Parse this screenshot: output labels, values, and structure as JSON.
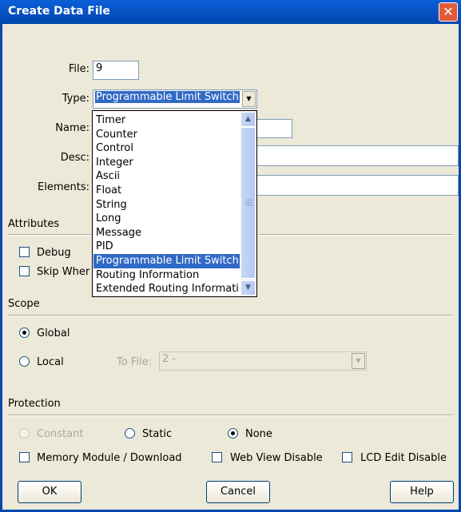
{
  "window": {
    "title": "Create Data File",
    "close_glyph": "✕"
  },
  "form": {
    "file_label": "File:",
    "file_value": "9",
    "type_label": "Type:",
    "type_value": "Programmable Limit Switch",
    "name_label": "Name:",
    "desc_label": "Desc:",
    "elements_label": "Elements:"
  },
  "type_options": [
    "Timer",
    "Counter",
    "Control",
    "Integer",
    "Ascii",
    "Float",
    "String",
    "Long",
    "Message",
    "PID",
    "Programmable Limit Switch",
    "Routing Information",
    "Extended Routing Informati"
  ],
  "type_selected_index": 10,
  "attributes": {
    "heading": "Attributes",
    "debug_label": "Debug",
    "skip_label": "Skip Wher"
  },
  "scope": {
    "heading": "Scope",
    "global_label": "Global",
    "local_label": "Local",
    "to_file_label": "To File:",
    "to_file_value": "2 -"
  },
  "protection": {
    "heading": "Protection",
    "constant_label": "Constant",
    "static_label": "Static",
    "none_label": "None",
    "memory_module_label": "Memory Module / Download",
    "web_view_label": "Web View Disable",
    "lcd_edit_label": "LCD Edit Disable"
  },
  "buttons": {
    "ok": "OK",
    "cancel": "Cancel",
    "help": "Help"
  },
  "icons": {
    "scroll_up": "▲",
    "scroll_down": "▼",
    "combo_arrow": "▼"
  }
}
